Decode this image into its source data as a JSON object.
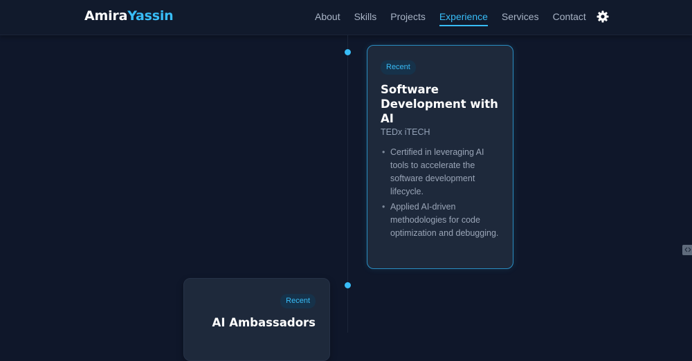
{
  "brand": {
    "first": "Amira",
    "last": "Yassin"
  },
  "nav": {
    "links": [
      {
        "label": "About"
      },
      {
        "label": "Skills"
      },
      {
        "label": "Projects"
      },
      {
        "label": "Experience",
        "active": true
      },
      {
        "label": "Services"
      },
      {
        "label": "Contact"
      }
    ],
    "theme_icon": "gear-icon"
  },
  "experience": [
    {
      "badge": "Recent",
      "title": "Software Development with AI",
      "org": "TEDx iTECH",
      "bullets": [
        "Certified in leveraging AI tools to accelerate the software development lifecycle.",
        "Applied AI-driven methodologies for code optimization and debugging."
      ]
    },
    {
      "badge": "Recent",
      "title": "AI Ambassadors"
    }
  ],
  "colors": {
    "background": "#0f172a",
    "card": "#1e293b",
    "accent": "#38bdf8",
    "text_muted": "#94a3b8"
  }
}
